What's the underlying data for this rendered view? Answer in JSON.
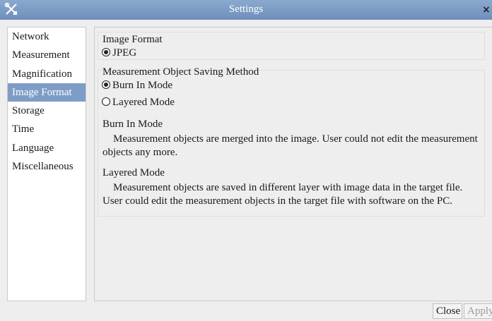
{
  "window": {
    "title": "Settings",
    "icon": "tools-icon",
    "close_glyph": "×"
  },
  "sidebar": {
    "items": [
      {
        "label": "Network"
      },
      {
        "label": "Measurement"
      },
      {
        "label": "Magnification"
      },
      {
        "label": "Image Format",
        "selected": true
      },
      {
        "label": "Storage"
      },
      {
        "label": "Time"
      },
      {
        "label": "Language"
      },
      {
        "label": "Miscellaneous"
      }
    ],
    "selected_color": "#7e9dc6"
  },
  "image_format": {
    "title": "Image Format",
    "option_jpeg": "JPEG",
    "selected": "JPEG"
  },
  "saving_method": {
    "title": "Measurement Object Saving Method",
    "option_burn_in": "Burn In Mode",
    "option_layered": "Layered Mode",
    "selected": "Burn In Mode",
    "burn_in_heading": "Burn In Mode",
    "burn_in_desc": "Measurement objects are merged into the image. User could not edit the measurement objects any more.",
    "layered_heading": "Layered Mode",
    "layered_desc": "Measurement objects are saved in different layer with image data in the target file. User could edit the measurement objects in the target file with software on the PC."
  },
  "footer": {
    "close_label": "Close",
    "apply_label": "Apply",
    "apply_enabled": false
  }
}
